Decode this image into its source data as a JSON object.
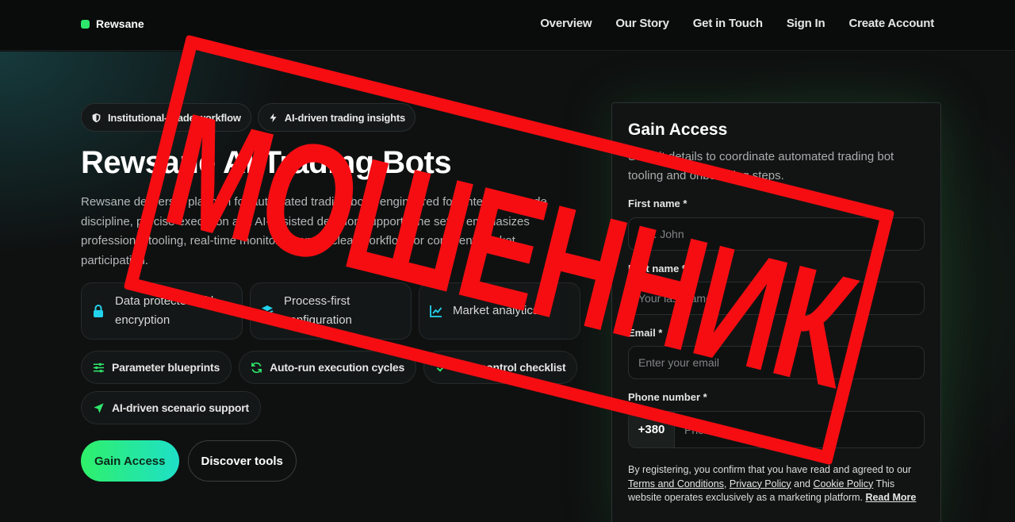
{
  "brand": {
    "name": "Rewsane",
    "accent": "#2ee86c"
  },
  "nav": {
    "links": [
      "Overview",
      "Our Story",
      "Get in Touch",
      "Sign In",
      "Create Account"
    ]
  },
  "hero": {
    "chips": [
      {
        "label": "Institutional-grade workflow",
        "icon": "shield-icon"
      },
      {
        "label": "AI-driven trading insights",
        "icon": "bolt-icon"
      }
    ],
    "title": "Rewsane AI Trading Bots",
    "description": "Rewsane delivers a platform for automated trading bots, engineered for enterprise-grade discipline, precise execution and AI-assisted decision support. The setup emphasizes professional tooling, real-time monitoring and a clear workflow for confident market participation.",
    "cards": [
      {
        "label": "Data protected with encryption",
        "icon": "lock-icon"
      },
      {
        "label": "Process-first configuration",
        "icon": "layers-icon"
      },
      {
        "label": "Market analytics",
        "icon": "chart-icon"
      }
    ],
    "tags": [
      {
        "label": "Parameter blueprints",
        "icon": "sliders-icon"
      },
      {
        "label": "Auto-run execution cycles",
        "icon": "refresh-icon"
      },
      {
        "label": "Risk control checklist",
        "icon": "check-icon"
      },
      {
        "label": "AI-driven scenario support",
        "icon": "send-icon"
      }
    ],
    "primary_button": "Gain Access",
    "secondary_button": "Discover tools"
  },
  "form": {
    "title": "Gain Access",
    "subtitle": "Submit details to coordinate automated trading bot tooling and onboarding steps.",
    "first_name_label": "First name *",
    "first_name_placeholder": "e.g. John",
    "last_name_label": "Last name *",
    "last_name_placeholder": "Your last name",
    "email_label": "Email *",
    "email_placeholder": "Enter your email",
    "phone_label": "Phone number *",
    "phone_code": "+380",
    "phone_placeholder": "Phone",
    "legal_prefix": "By registering, you confirm that you have read and agreed to our",
    "terms_link": "Terms and Conditions",
    "privacy_link": "Privacy Policy",
    "and_text": "and",
    "cookie_link": "Cookie Policy",
    "legal_suffix": "This website operates exclusively as a marketing platform.",
    "read_more_link": "Read More"
  },
  "stamp": {
    "text": "МОШЕННИК",
    "color": "#f50d12"
  }
}
